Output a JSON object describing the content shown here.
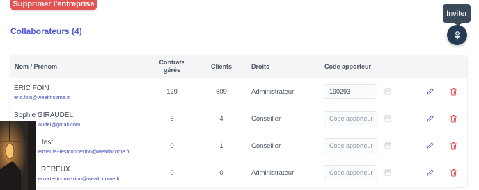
{
  "actions": {
    "delete_company_label": "Supprimer l'entreprise",
    "invite_tooltip": "Inviter"
  },
  "section": {
    "title": "Collaborateurs (4)"
  },
  "table": {
    "headers": {
      "name": "Nom / Prénom",
      "contracts": "Contrats gérés",
      "clients": "Clients",
      "rights": "Droits",
      "code": "Code apporteur"
    },
    "code_placeholder": "Code apporteur",
    "rows": [
      {
        "name": "ERIC FOIN",
        "email": "eric.foin@wealthcome.fr",
        "contracts": "129",
        "clients": "609",
        "rights": "Administrateur",
        "code": "190293"
      },
      {
        "name": "Sophie GIRAUDEL",
        "email": "audel@gmail.com",
        "contracts": "5",
        "clients": "4",
        "rights": "Conseiller",
        "code": ""
      },
      {
        "name": "test",
        "email": "elmeule+testconnexion@wealthcome.fr",
        "contracts": "0",
        "clients": "1",
        "rights": "Conseiller",
        "code": ""
      },
      {
        "name": "REREUX",
        "email": "eux+testconnexion@wealthcome.fr",
        "contracts": "0",
        "clients": "0",
        "rights": "Administrateur",
        "code": ""
      }
    ]
  },
  "colors": {
    "danger": "#e25353",
    "accent": "#4f5bd5",
    "fab": "#233a52",
    "edit_icon": "#5b5bd6",
    "delete_icon": "#e25353"
  },
  "icons": {
    "fab": "person-plus-icon",
    "save": "save-icon",
    "edit": "pencil-icon",
    "delete": "trash-icon"
  }
}
